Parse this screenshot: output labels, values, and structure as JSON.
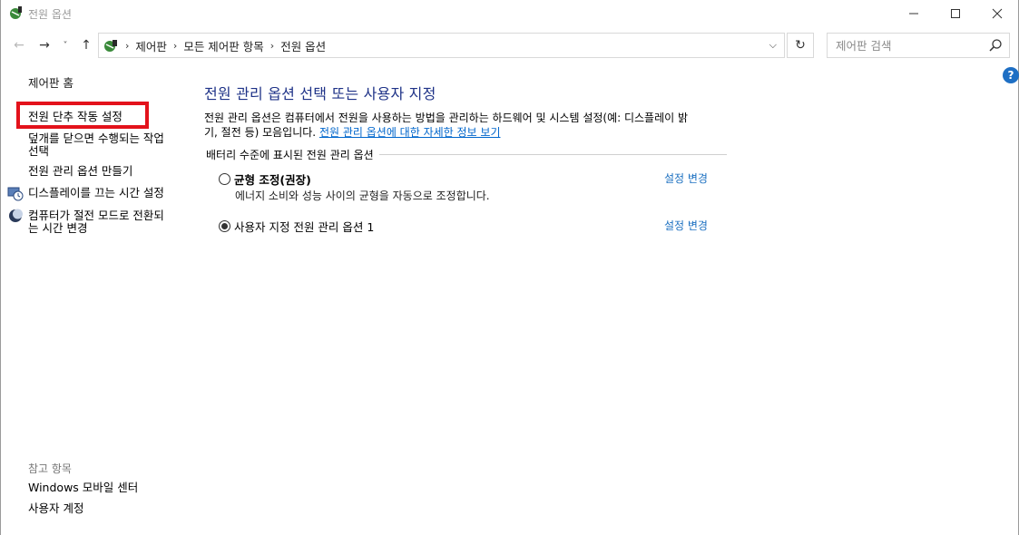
{
  "window": {
    "title": "전원 옵션"
  },
  "nav": {
    "breadcrumb": [
      "제어판",
      "모든 제어판 항목",
      "전원 옵션"
    ],
    "search_placeholder": "제어판 검색"
  },
  "sidebar": {
    "home": "제어판 홈",
    "items": [
      "전원 단추 작동 설정",
      "덮개를 닫으면 수행되는 작업",
      "선택",
      "전원 관리 옵션 만들기",
      "디스플레이를 끄는 시간 설정",
      "컴퓨터가 절전 모드로 전환되",
      "는 시간 변경"
    ],
    "see_also_title": "참고 항목",
    "see_also": [
      "Windows 모바일 센터",
      "사용자 계정"
    ]
  },
  "main": {
    "heading": "전원 관리 옵션 선택 또는 사용자 지정",
    "desc_line1": "전원 관리 옵션은 컴퓨터에서 전원을 사용하는 방법을 관리하는 하드웨어 및 시스템 설정(예: 디스플레이 밝",
    "desc_line2": "기, 절전 등) 모음입니다.",
    "desc_link": "전원 관리 옵션에 대한 자세한 정보 보기",
    "group_title": "배터리 수준에 표시된 전원 관리 옵션",
    "plans": [
      {
        "name": "균형 조정(권장)",
        "desc": "에너지 소비와 성능 사이의 균형을 자동으로 조정합니다.",
        "selected": false,
        "change": "설정 변경"
      },
      {
        "name": "사용자 지정 전원 관리 옵션 1",
        "desc": "",
        "selected": true,
        "change": "설정 변경"
      }
    ]
  },
  "colors": {
    "heading": "#1e3287",
    "link": "#0066cc",
    "highlight": "#e3121b"
  }
}
